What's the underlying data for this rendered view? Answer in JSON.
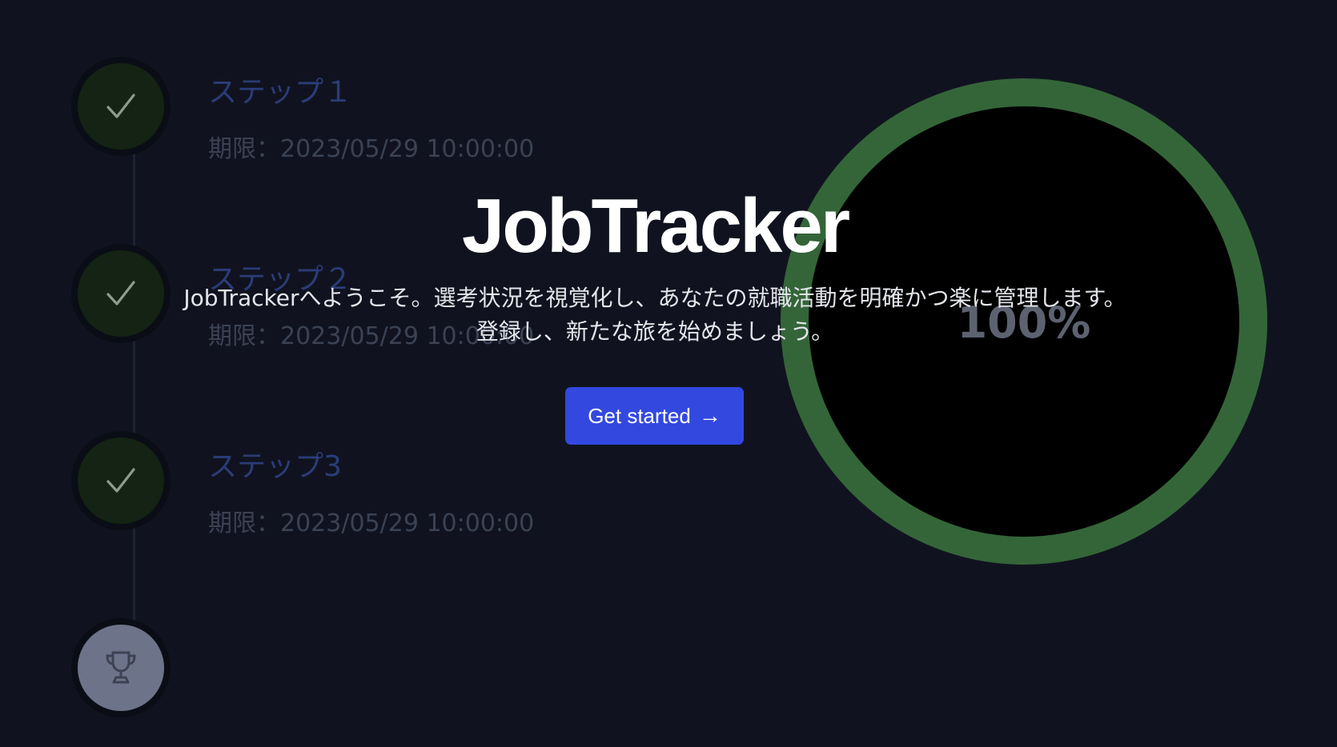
{
  "app": {
    "title": "JobTracker",
    "description_line1": "JobTrackerへようこそ。選考状況を視覚化し、あなたの就職活動を明確かつ楽に管理します。",
    "description_line2": "登録し、新たな旅を始めましょう。",
    "cta_label": "Get started",
    "cta_arrow": "→"
  },
  "timeline": {
    "steps": [
      {
        "title": "ステップ１",
        "deadline": "期限：2023/05/29 10:00:00",
        "status": "completed",
        "icon": "check-icon"
      },
      {
        "title": "ステップ２",
        "deadline": "期限：2023/05/29 10:00:00",
        "status": "completed",
        "icon": "check-icon"
      },
      {
        "title": "ステップ3",
        "deadline": "期限：2023/05/29 10:00:00",
        "status": "completed",
        "icon": "check-icon"
      }
    ],
    "goal": {
      "icon": "trophy-icon"
    }
  },
  "progress": {
    "label": "100%",
    "value": 1.0
  },
  "colors": {
    "background": "#10131f",
    "accent": "#3348df",
    "progress_ring": "#346538",
    "step_completed": "#142313",
    "goal_circle": "#6d7489"
  }
}
